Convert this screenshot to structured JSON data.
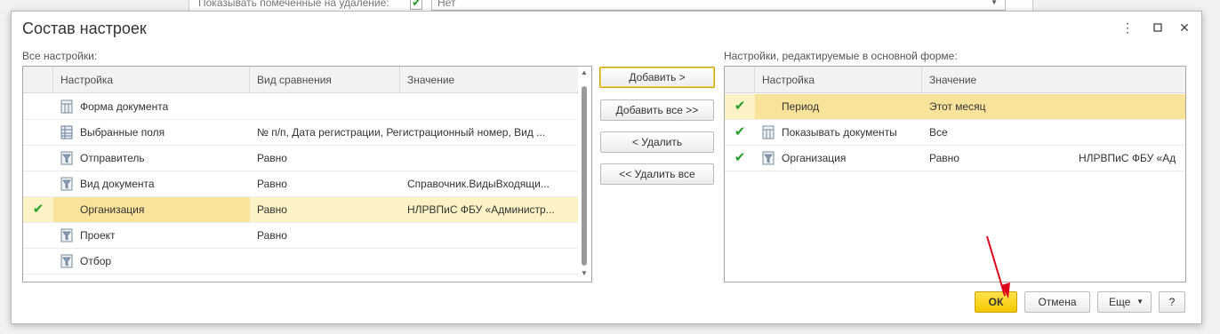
{
  "background": {
    "checkbox_label": "Показывать помеченные на удаление:",
    "field_value": "Нет"
  },
  "dialog": {
    "title": "Состав настроек",
    "more_icon": "kebab-menu-icon",
    "maximize_icon": "maximize-icon",
    "close_icon": "close-icon"
  },
  "left": {
    "caption": "Все настройки:",
    "columns": [
      "Настройка",
      "Вид сравнения",
      "Значение"
    ],
    "rows": [
      {
        "checked": false,
        "icon": "grid-doc-icon",
        "name": "Форма документа",
        "comparison": "",
        "value": ""
      },
      {
        "checked": false,
        "icon": "fields-list-icon",
        "name": "Выбранные поля",
        "comparison": "№ п/п, Дата регистрации, Регистрационный номер, Вид ...",
        "value": ""
      },
      {
        "checked": false,
        "icon": "filter-icon",
        "name": "Отправитель",
        "comparison": "Равно",
        "value": ""
      },
      {
        "checked": false,
        "icon": "filter-icon",
        "name": "Вид документа",
        "comparison": "Равно",
        "value": "Справочник.ВидыВходящи..."
      },
      {
        "checked": true,
        "icon": "filter-icon",
        "name": "Организация",
        "comparison": "Равно",
        "value": "НЛРВПиС ФБУ «Администр..."
      },
      {
        "checked": false,
        "icon": "filter-icon",
        "name": "Проект",
        "comparison": "Равно",
        "value": ""
      },
      {
        "checked": false,
        "icon": "filter-icon",
        "name": "Отбор",
        "comparison": "",
        "value": ""
      }
    ]
  },
  "middle": {
    "add": "Добавить >",
    "add_all": "Добавить все >>",
    "remove": "< Удалить",
    "remove_all": "<< Удалить все"
  },
  "right": {
    "caption": "Настройки, редактируемые в основной форме:",
    "columns": [
      "Настройка",
      "Значение"
    ],
    "rows": [
      {
        "checked": true,
        "icon": "grid-doc-icon",
        "name": "Период",
        "value": "Этот месяц",
        "extra": ""
      },
      {
        "checked": true,
        "icon": "grid-doc-icon",
        "name": "Показывать документы",
        "value": "Все",
        "extra": ""
      },
      {
        "checked": true,
        "icon": "filter-icon",
        "name": "Организация",
        "value": "Равно",
        "extra": "НЛРВПиС ФБУ «Ад"
      }
    ]
  },
  "footer": {
    "ok": "ОК",
    "cancel": "Отмена",
    "more": "Еще",
    "help": "?"
  },
  "colors": {
    "accent_yellow": "#f5c800",
    "selected_row": "#fbf2c5",
    "check_green": "#2a9d2a",
    "annotation_red": "#e0001b"
  }
}
